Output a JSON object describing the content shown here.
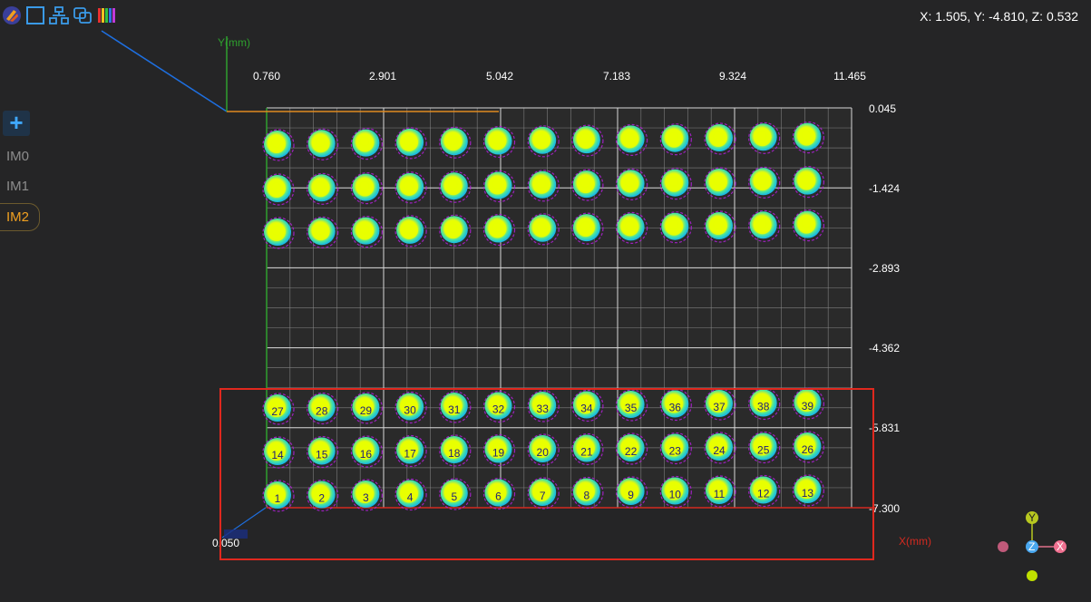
{
  "toolbar": {
    "icons": [
      "logo-icon",
      "square-view-icon",
      "hierarchy-icon",
      "copy-windows-icon",
      "colorbar-icon"
    ]
  },
  "coordinate_readout": "X: 1.505, Y: -4.810, Z: 0.532",
  "sidebar": {
    "add_label": "+",
    "items": [
      {
        "label": "IM0",
        "active": false
      },
      {
        "label": "IM1",
        "active": false
      },
      {
        "label": "IM2",
        "active": true
      }
    ]
  },
  "plot": {
    "y_axis_label": "Y(mm)",
    "x_axis_label": "X(mm)",
    "x_ticks": [
      "0.760",
      "2.901",
      "5.042",
      "7.183",
      "9.324",
      "11.465"
    ],
    "y_ticks": [
      "0.045",
      "-1.424",
      "-2.893",
      "-4.362",
      "-5.831",
      "-7.300"
    ],
    "origin_label": "0.050",
    "top_dot_rows": 3,
    "dots_per_row": 13,
    "numbered_rows": [
      [
        27,
        28,
        29,
        30,
        31,
        32,
        33,
        34,
        35,
        36,
        37,
        38,
        39
      ],
      [
        14,
        15,
        16,
        17,
        18,
        19,
        20,
        21,
        22,
        23,
        24,
        25,
        26
      ],
      [
        1,
        2,
        3,
        4,
        5,
        6,
        7,
        8,
        9,
        10,
        11,
        12,
        13
      ]
    ],
    "colors": {
      "dot_core": "#e8ff00",
      "dot_mid": "#3fe0a0",
      "dot_ring_cyan": "#19c6e8",
      "dot_ring_purple": "#b020d8",
      "grid": "#8a8a8a",
      "grid_major": "#d8d8d8",
      "selection_box": "#e0281e",
      "x_axis": "#d42a20",
      "y_axis": "#2ea02e"
    }
  },
  "gizmo": {
    "y": "Y",
    "z": "Z",
    "x": "X"
  }
}
